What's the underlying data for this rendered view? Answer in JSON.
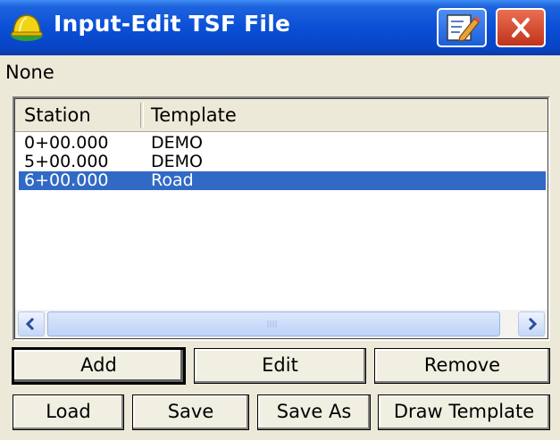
{
  "window": {
    "title": "Input-Edit TSF File",
    "icons": {
      "app": "hardhat-icon",
      "edit": "edit-icon",
      "close": "close-icon"
    }
  },
  "status_text": "None",
  "table": {
    "columns": [
      "Station",
      "Template"
    ],
    "rows": [
      {
        "station": "0+00.000",
        "template": "DEMO",
        "selected": false
      },
      {
        "station": "5+00.000",
        "template": "DEMO",
        "selected": false
      },
      {
        "station": "6+00.000",
        "template": "Road",
        "selected": true
      }
    ]
  },
  "scrollbar": {
    "left_icon": "chevron-left-icon",
    "right_icon": "chevron-right-icon",
    "grip_icon": "grip-icon"
  },
  "buttons": {
    "add": "Add",
    "edit": "Edit",
    "remove": "Remove",
    "load": "Load",
    "save": "Save",
    "save_as": "Save As",
    "draw_template": "Draw Template"
  },
  "colors": {
    "title_bar": "#0a4fd6",
    "selection": "#316ac5",
    "close": "#c0341b",
    "background": "#ece9d8"
  }
}
